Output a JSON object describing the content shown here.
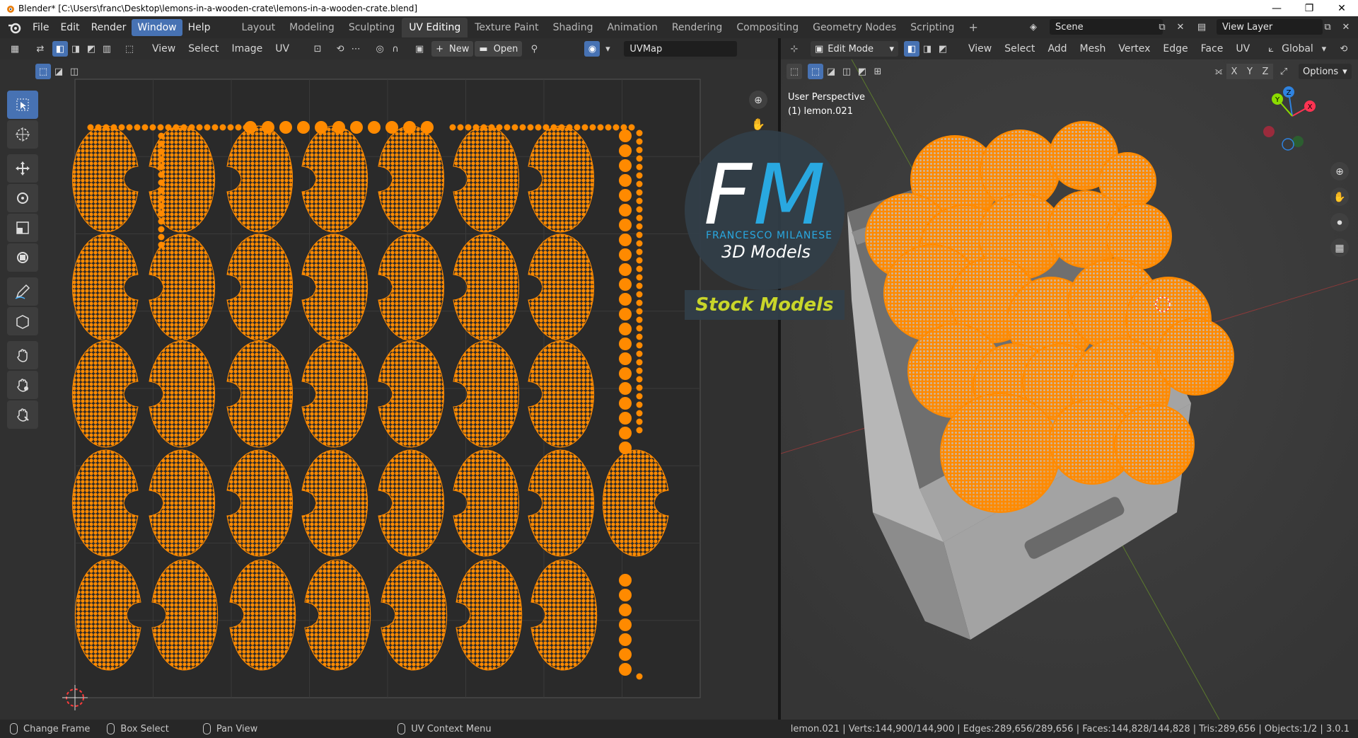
{
  "window": {
    "title": "Blender* [C:\\Users\\franc\\Desktop\\lemons-in-a-wooden-crate\\lemons-in-a-wooden-crate.blend]",
    "min_glyph": "—",
    "max_glyph": "❐",
    "close_glyph": "✕"
  },
  "menu": [
    "File",
    "Edit",
    "Render",
    "Window",
    "Help"
  ],
  "workspaces": [
    "Layout",
    "Modeling",
    "Sculpting",
    "UV Editing",
    "Texture Paint",
    "Shading",
    "Animation",
    "Rendering",
    "Compositing",
    "Geometry Nodes",
    "Scripting"
  ],
  "scene": {
    "name": "Scene",
    "view_layer": "View Layer"
  },
  "uv_editor": {
    "menus": [
      "View",
      "Select",
      "Image",
      "UV"
    ],
    "new_label": "New",
    "open_label": "Open",
    "uvmap": "UVMap"
  },
  "viewport": {
    "mode": "Edit Mode",
    "menus": [
      "View",
      "Select",
      "Add",
      "Mesh",
      "Vertex",
      "Edge",
      "Face",
      "UV"
    ],
    "orientation": "Global",
    "axis_x": "X",
    "axis_y": "Y",
    "axis_z": "Z",
    "options": "Options",
    "overlay_line1": "User Perspective",
    "overlay_line2": "(1) lemon.021"
  },
  "watermark": {
    "letter_f": "F",
    "letter_m": "M",
    "name": "FRANCESCO MILANESE",
    "tagline": "3D Models",
    "stock": "Stock Models"
  },
  "status": {
    "change_frame": "Change Frame",
    "box_select": "Box Select",
    "pan_view": "Pan View",
    "context_menu": "UV Context Menu",
    "stats": "lemon.021 | Verts:144,900/144,900 | Edges:289,656/289,656 | Faces:144,828/144,828 | Tris:289,656 | Objects:1/2 | 3.0.1"
  },
  "colors": {
    "orange": "#ff8a00",
    "accent": "#4772b3",
    "wm_blue": "#29a8e0",
    "wm_green": "#c9d62a"
  }
}
